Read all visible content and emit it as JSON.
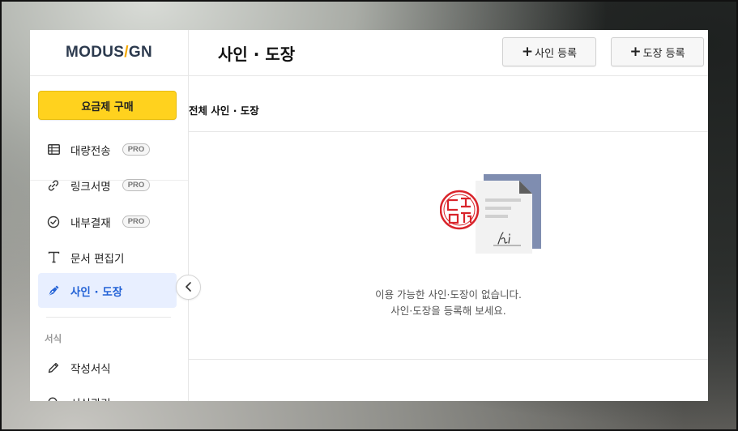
{
  "app": {
    "logo_left": "MODUS",
    "logo_slash": "/",
    "logo_right": "GN"
  },
  "sidebar": {
    "buy_button": "요금제 구매",
    "items": [
      {
        "label": "대량전송",
        "badge": "PRO",
        "icon": "table-icon"
      },
      {
        "label": "링크서명",
        "badge": "PRO",
        "icon": "link-icon"
      },
      {
        "label": "내부결재",
        "badge": "PRO",
        "icon": "check-circle-icon"
      },
      {
        "label": "문서 편집기",
        "badge": "",
        "icon": "text-icon"
      },
      {
        "label": "사인 · 도장",
        "badge": "",
        "icon": "pen-nib-icon"
      }
    ],
    "section_label": "서식",
    "section_items": [
      {
        "label": "작성서식",
        "icon": "pencil-icon"
      },
      {
        "label": "서식관리",
        "icon": "search-icon"
      }
    ]
  },
  "header": {
    "title": "사인 · 도장",
    "add_sign_button": "사인 등록",
    "add_stamp_button": "도장 등록"
  },
  "content": {
    "section_title": "전체 사인 · 도장",
    "empty_line1": "이용 가능한 사인·도장이 없습니다.",
    "empty_line2": "사인·도장을 등록해 보세요."
  },
  "colors": {
    "accent_yellow": "#ffd21e",
    "active_blue": "#2463d6",
    "active_bg": "#e8efff",
    "logo_navy": "#2c3a4e",
    "logo_slash": "#f5a800",
    "stamp_red": "#d9242b"
  }
}
